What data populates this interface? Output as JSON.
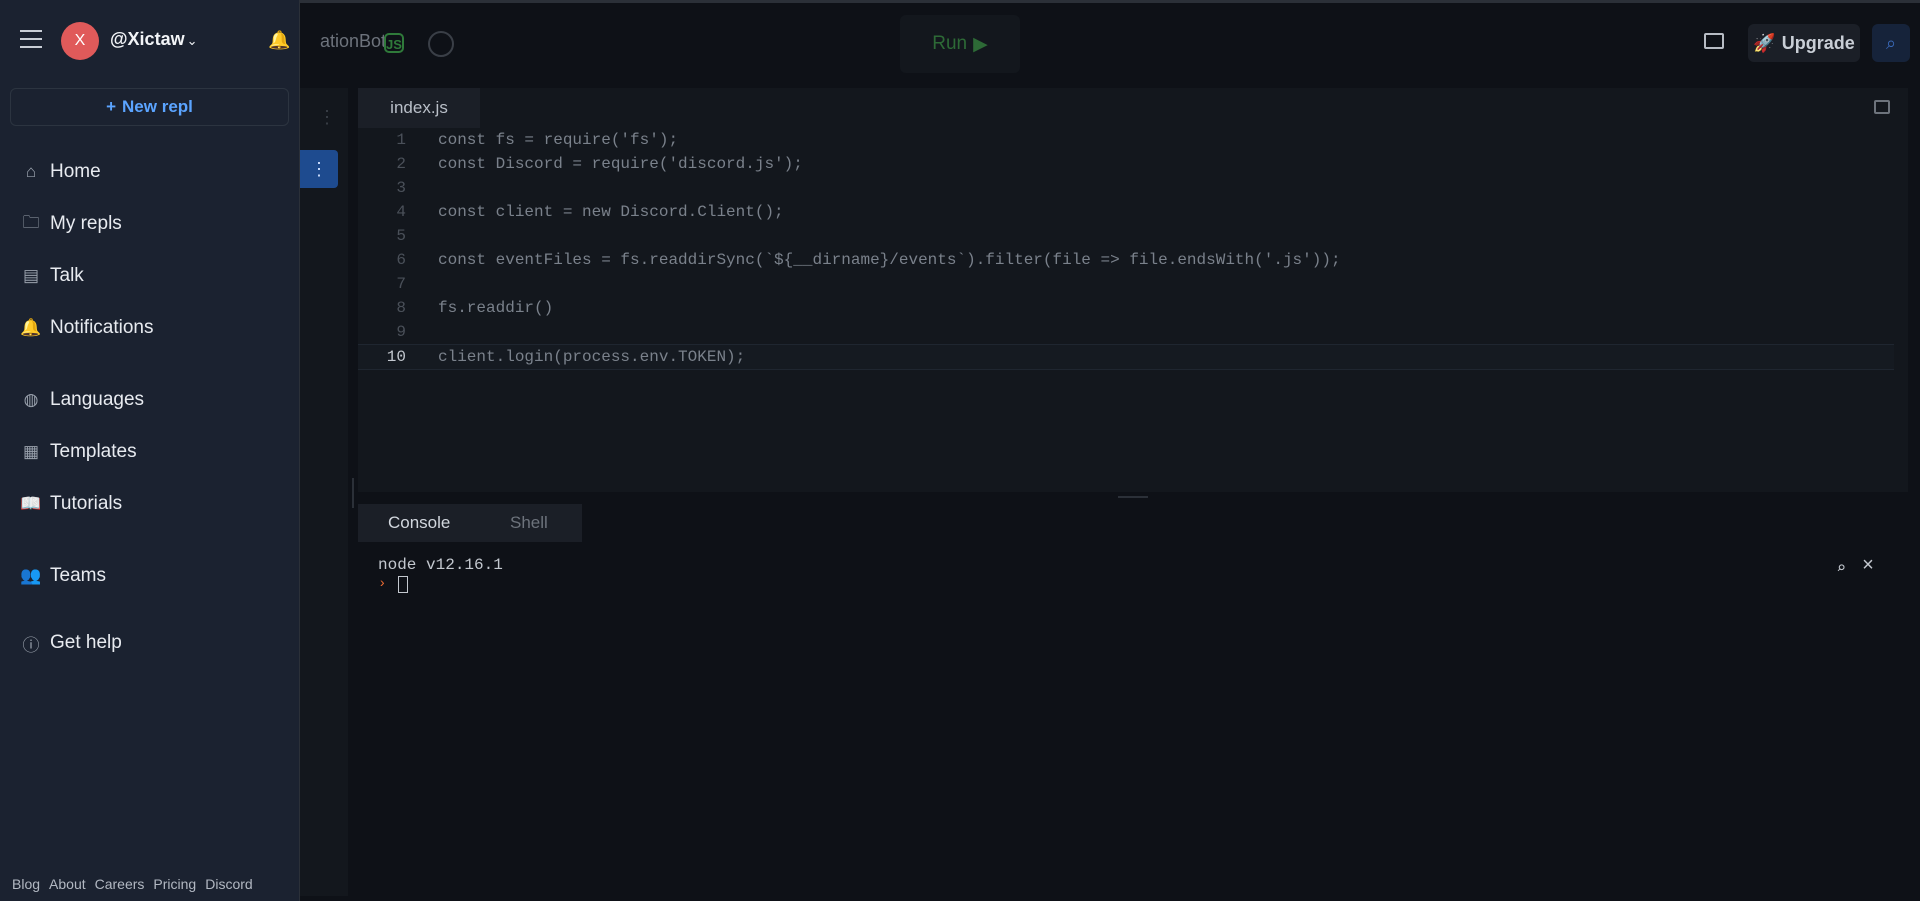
{
  "topbar": {
    "repl_title": "ationBot",
    "node_badge": "JS",
    "run_label": "Run",
    "upgrade_label": "Upgrade"
  },
  "sidebar": {
    "username": "@Xictaw",
    "avatar_initials": "X",
    "new_repl_label": "New repl",
    "nav": [
      {
        "label": "Home",
        "icon": "home-icon"
      },
      {
        "label": "My repls",
        "icon": "folder-icon"
      },
      {
        "label": "Talk",
        "icon": "talk-icon"
      },
      {
        "label": "Notifications",
        "icon": "bell-icon"
      },
      {
        "label": "Languages",
        "icon": "globe-icon"
      },
      {
        "label": "Templates",
        "icon": "templates-icon"
      },
      {
        "label": "Tutorials",
        "icon": "book-icon"
      },
      {
        "label": "Teams",
        "icon": "teams-icon"
      },
      {
        "label": "Get help",
        "icon": "info-icon"
      }
    ],
    "footer_links": [
      "Blog",
      "About",
      "Careers",
      "Pricing",
      "Discord"
    ]
  },
  "editor": {
    "tab": "index.js",
    "current_line": 10,
    "lines": [
      {
        "n": "1",
        "code": "const fs = require('fs');"
      },
      {
        "n": "2",
        "code": "const Discord = require('discord.js');"
      },
      {
        "n": "3",
        "code": ""
      },
      {
        "n": "4",
        "code": "const client = new Discord.Client();"
      },
      {
        "n": "5",
        "code": ""
      },
      {
        "n": "6",
        "code": "const eventFiles = fs.readdirSync(`${__dirname}/events`).filter(file => file.endsWith('.js'));"
      },
      {
        "n": "7",
        "code": ""
      },
      {
        "n": "8",
        "code": "fs.readdir()"
      },
      {
        "n": "9",
        "code": ""
      },
      {
        "n": "10",
        "code": "client.login(process.env.TOKEN);"
      }
    ]
  },
  "console": {
    "tabs": [
      "Console",
      "Shell"
    ],
    "output": "node v12.16.1",
    "prompt": "›"
  }
}
